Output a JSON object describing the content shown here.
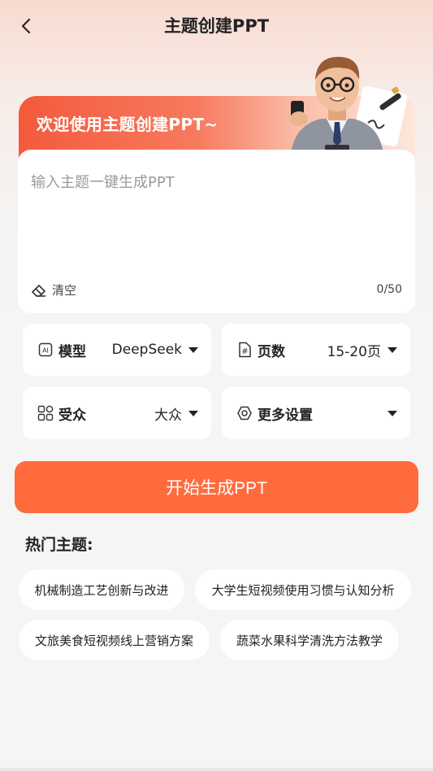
{
  "header": {
    "title": "主题创建PPT",
    "back_icon": "chevron-left-icon"
  },
  "banner": {
    "title": "欢迎使用主题创建PPT~"
  },
  "input": {
    "placeholder": "输入主题一键生成PPT",
    "value": "",
    "clear_label": "清空",
    "counter": "0/50"
  },
  "options": {
    "model": {
      "icon": "ai-icon",
      "label": "模型",
      "value": "DeepSeek"
    },
    "pages": {
      "icon": "hash-icon",
      "label": "页数",
      "value": "15-20页"
    },
    "audience": {
      "icon": "grid-icon",
      "label": "受众",
      "value": "大众"
    },
    "more": {
      "icon": "settings-icon",
      "label": "更多设置"
    }
  },
  "generate_button": "开始生成PPT",
  "hot_topics": {
    "title": "热门主题:",
    "items": [
      "机械制造工艺创新与改进",
      "大学生短视频使用习惯与认知分析",
      "文旅美食短视频线上营销方案",
      "蔬菜水果科学清洗方法教学"
    ]
  },
  "colors": {
    "accent": "#ff6b3d",
    "banner_start": "#f45a3c"
  }
}
